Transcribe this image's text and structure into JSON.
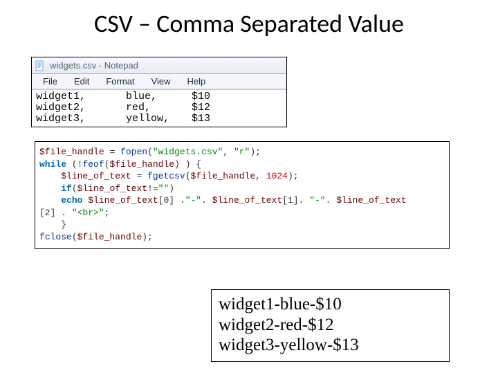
{
  "slide": {
    "title": "CSV – Comma Separated Value"
  },
  "notepad": {
    "title": "widgets.csv - Notepad",
    "menu": {
      "file": "File",
      "edit": "Edit",
      "format": "Format",
      "view": "View",
      "help": "Help"
    },
    "rows": [
      {
        "name": "widget1,",
        "color": "blue,",
        "price": "$10"
      },
      {
        "name": "widget2,",
        "color": "red,",
        "price": "$12"
      },
      {
        "name": "widget3,",
        "color": "yellow,",
        "price": "$13"
      }
    ]
  },
  "code": {
    "tokens": {
      "var_fh": "$file_handle",
      "func_fopen": "fopen",
      "str_file": "\"widgets.csv\"",
      "str_mode": "\"r\"",
      "kw_while": "while",
      "func_feof": "feof",
      "var_line": "$line_of_text",
      "func_fgetcsv": "fgetcsv",
      "num_buf": "1024",
      "kw_if": "if",
      "str_empty": "\"\"",
      "kw_echo": "echo",
      "str_dash": "\"-\"",
      "str_br": "\"<br>\"",
      "func_fclose": "fclose",
      "idx0": "[0]",
      "idx1": "[1]",
      "idx2": "[2]"
    }
  },
  "output": {
    "lines": [
      "widget1-blue-$10",
      "widget2-red-$12",
      "widget3-yellow-$13"
    ]
  }
}
